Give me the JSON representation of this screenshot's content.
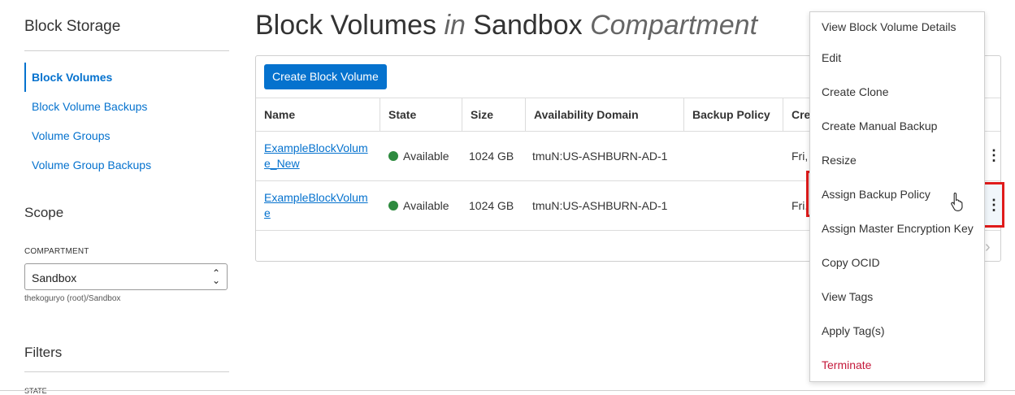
{
  "sidebar": {
    "title": "Block Storage",
    "nav": [
      {
        "label": "Block Volumes",
        "active": true
      },
      {
        "label": "Block Volume Backups"
      },
      {
        "label": "Volume Groups"
      },
      {
        "label": "Volume Group Backups"
      }
    ],
    "scope_title": "Scope",
    "compartment_label": "COMPARTMENT",
    "compartment_value": "Sandbox",
    "compartment_path": "thekoguryo (root)/Sandbox",
    "filters_title": "Filters",
    "state_label": "STATE"
  },
  "header": {
    "title_part1": "Block Volumes",
    "title_in": "in",
    "title_part2": "Sandbox",
    "title_part3": "Compartment"
  },
  "toolbar": {
    "create_label": "Create Block Volume"
  },
  "table": {
    "columns": [
      "Name",
      "State",
      "Size",
      "Availability Domain",
      "Backup Policy",
      "Cre"
    ],
    "rows": [
      {
        "name": "ExampleBlockVolume_New",
        "state": "Available",
        "size": "1024 GB",
        "ad": "tmuN:US-ASHBURN-AD-1",
        "backup_policy": "",
        "created": "Fri,"
      },
      {
        "name": "ExampleBlockVolume",
        "state": "Available",
        "size": "1024 GB",
        "ad": "tmuN:US-ASHBURN-AD-1",
        "backup_policy": "",
        "created": "Fri,"
      }
    ]
  },
  "menu": {
    "items": [
      "View Block Volume Details",
      "Edit",
      "Create Clone",
      "Create Manual Backup",
      "Resize",
      "Assign Backup Policy",
      "Assign Master Encryption Key",
      "Copy OCID",
      "View Tags",
      "Apply Tag(s)",
      "Terminate"
    ]
  },
  "icons": {
    "kebab": "more-vertical-icon",
    "pager": "chevron-right-icon",
    "select": "select-arrows-icon"
  },
  "colors": {
    "accent": "#0572ce",
    "available": "#2d8a3e",
    "danger": "#c4193b",
    "highlight": "#e01b1b"
  }
}
